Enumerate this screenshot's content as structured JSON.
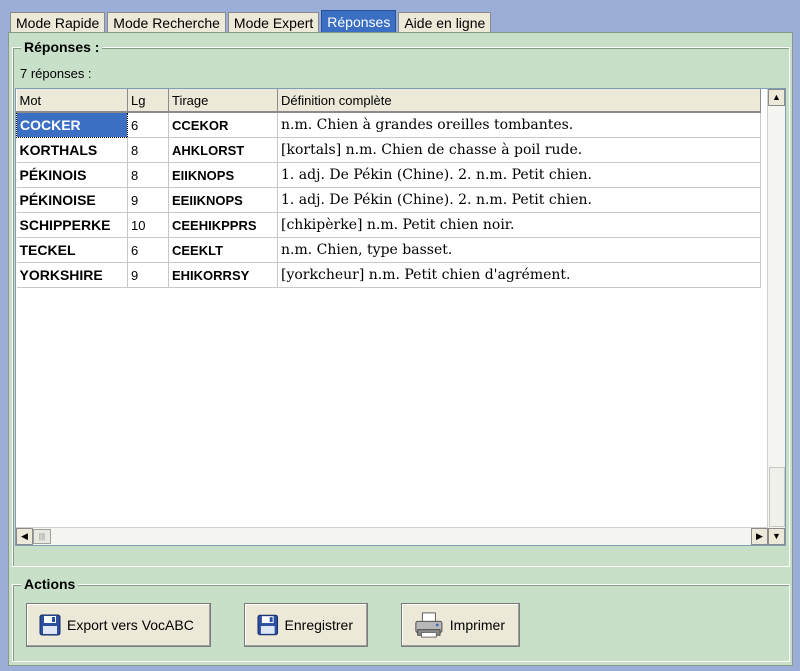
{
  "tabs": [
    {
      "label": "Mode Rapide",
      "active": false
    },
    {
      "label": "Mode Recherche",
      "active": false
    },
    {
      "label": "Mode Expert",
      "active": false
    },
    {
      "label": "Réponses",
      "active": true
    },
    {
      "label": "Aide en ligne",
      "active": false
    }
  ],
  "responses": {
    "title": "Réponses :",
    "count": "7 réponses :",
    "columns": [
      "Mot",
      "Lg",
      "Tirage",
      "Définition complète"
    ],
    "rows": [
      {
        "mot": "COCKER",
        "lg": "6",
        "tirage": "CCEKOR",
        "def": "n.m. Chien à grandes oreilles tombantes."
      },
      {
        "mot": "KORTHALS",
        "lg": "8",
        "tirage": "AHKLORST",
        "def": "[kortals] n.m. Chien de chasse à poil rude."
      },
      {
        "mot": "PÉKINOIS",
        "lg": "8",
        "tirage": "EIIKNOPS",
        "def": "1. adj. De Pékin (Chine). 2. n.m. Petit chien."
      },
      {
        "mot": "PÉKINOISE",
        "lg": "9",
        "tirage": "EEIIKNOPS",
        "def": "1. adj. De Pékin (Chine). 2. n.m. Petit chien."
      },
      {
        "mot": "SCHIPPERKE",
        "lg": "10",
        "tirage": "CEEHIKPPRS",
        "def": "[chkipèrke] n.m. Petit chien noir."
      },
      {
        "mot": "TECKEL",
        "lg": "6",
        "tirage": "CEEKLT",
        "def": "n.m. Chien, type basset."
      },
      {
        "mot": "YORKSHIRE",
        "lg": "9",
        "tirage": "EHIKORRSY",
        "def": "[yorkcheur] n.m. Petit chien d'agrément."
      }
    ]
  },
  "actions": {
    "title": "Actions",
    "export_label": "Export vers VocABC",
    "save_label": "Enregistrer",
    "print_label": "Imprimer"
  }
}
